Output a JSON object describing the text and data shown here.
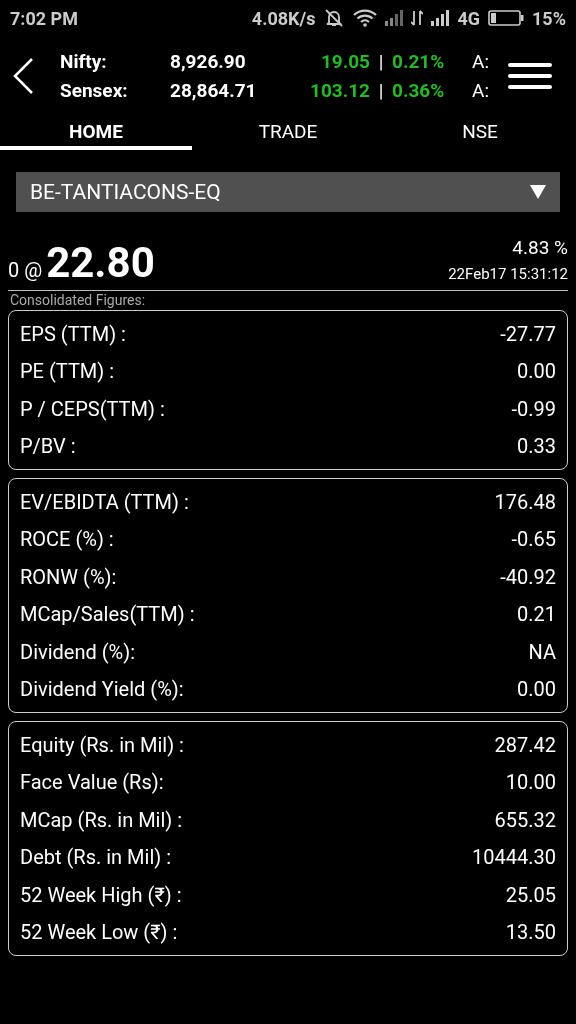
{
  "status_bar": {
    "time": "7:02 PM",
    "speed": "4.08K/s",
    "network": "4G",
    "battery": "15%"
  },
  "indices": [
    {
      "name": "Nifty:",
      "value": "8,926.90",
      "change": "19.05",
      "separator": "|",
      "percent": "0.21%",
      "extra": "A:"
    },
    {
      "name": "Sensex:",
      "value": "28,864.71",
      "change": "103.12",
      "separator": "|",
      "percent": "0.36%",
      "extra": "A:"
    }
  ],
  "tabs": [
    {
      "label": "HOME",
      "selected": true
    },
    {
      "label": "TRADE",
      "selected": false
    },
    {
      "label": "NSE",
      "selected": false
    }
  ],
  "scrip_select": {
    "value": "BE-TANTIACONS-EQ"
  },
  "quote": {
    "quantity": "0 @",
    "price": "22.80",
    "change_percent": "4.83 %",
    "timestamp": "22Feb17 15:31:12"
  },
  "section_title": "Consolidated Figures:",
  "cards": [
    [
      {
        "label": "EPS (TTM) :",
        "value": "-27.77"
      },
      {
        "label": "PE (TTM) :",
        "value": "0.00"
      },
      {
        "label": "P / CEPS(TTM) :",
        "value": "-0.99"
      },
      {
        "label": "P/BV :",
        "value": "0.33"
      }
    ],
    [
      {
        "label": "EV/EBIDTA (TTM) :",
        "value": "176.48"
      },
      {
        "label": "ROCE (%) :",
        "value": "-0.65"
      },
      {
        "label": "RONW (%):",
        "value": "-40.92"
      },
      {
        "label": "MCap/Sales(TTM) :",
        "value": "0.21"
      },
      {
        "label": "Dividend (%):",
        "value": "NA"
      },
      {
        "label": "Dividend Yield (%):",
        "value": "0.00"
      }
    ],
    [
      {
        "label": "Equity (Rs. in Mil) :",
        "value": "287.42"
      },
      {
        "label": "Face Value (Rs):",
        "value": "10.00"
      },
      {
        "label": "MCap (Rs. in Mil) :",
        "value": "655.32"
      },
      {
        "label": "Debt (Rs. in Mil) :",
        "value": "10444.30"
      },
      {
        "label": "52 Week High (₹) :",
        "value": "25.05"
      },
      {
        "label": "52 Week Low (₹) :",
        "value": "13.50"
      }
    ]
  ]
}
